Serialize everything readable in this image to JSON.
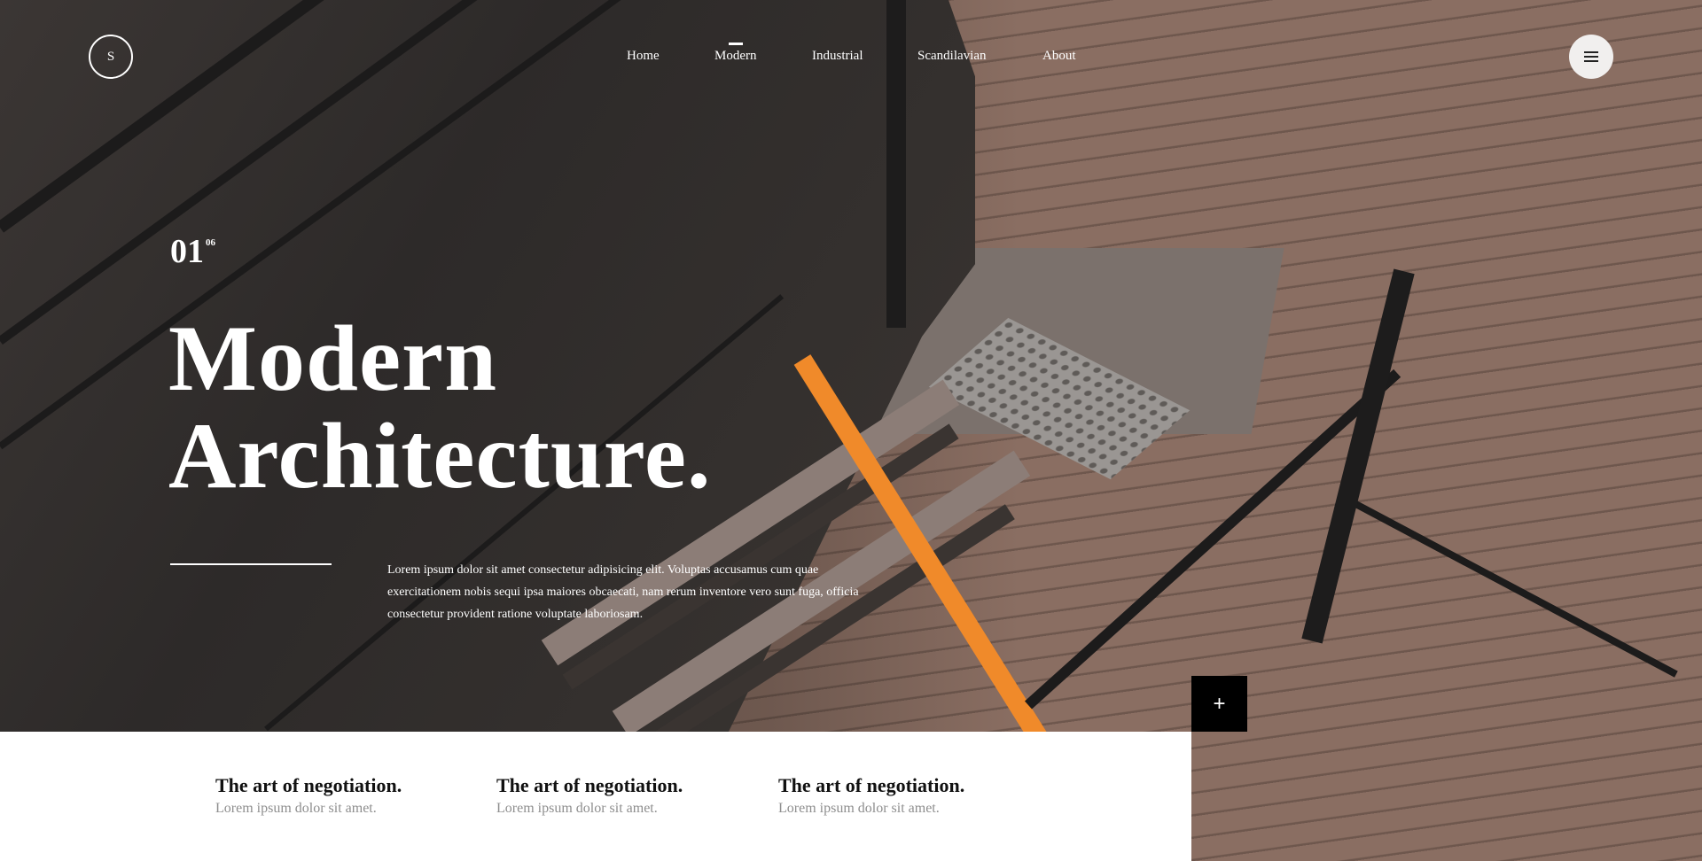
{
  "logo": {
    "letter": "S"
  },
  "nav": {
    "items": [
      {
        "label": "Home",
        "active": false
      },
      {
        "label": "Modern",
        "active": true
      },
      {
        "label": "Industrial",
        "active": false
      },
      {
        "label": "Scandilavian",
        "active": false
      },
      {
        "label": "About",
        "active": false
      }
    ]
  },
  "menu": {
    "icon": "hamburger-menu-icon"
  },
  "hero": {
    "slide_current": "01",
    "slide_total": "06",
    "title_line1": "Modern",
    "title_line2": "Architecture.",
    "description": "Lorem ipsum dolor sit amet consectetur adipisicing elit. Voluptas accusamus cum quae exercitationem nobis sequi ipsa maiores obcaecati, nam rerum inventore vero sunt fuga, officia consectetur provident ratione voluptate laboriosam."
  },
  "plus_button": {
    "label": "+"
  },
  "features": [
    {
      "title": "The art of negotiation.",
      "text": "Lorem ipsum dolor sit amet."
    },
    {
      "title": "The art of negotiation.",
      "text": "Lorem ipsum dolor sit amet."
    },
    {
      "title": "The art of negotiation.",
      "text": "Lorem ipsum dolor sit amet."
    }
  ],
  "colors": {
    "accent_orange": "#f08a2a",
    "text_light": "#ffffff",
    "panel_bg": "#ffffff",
    "feature_title": "#111111",
    "feature_text": "#8e8e8e"
  }
}
